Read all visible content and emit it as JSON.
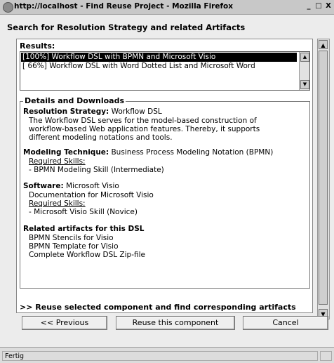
{
  "window": {
    "title": "http://localhost - Find Reuse Project - Mozilla Firefox",
    "minimize_label": "_",
    "maximize_label": "□",
    "close_label": "X"
  },
  "page": {
    "heading": "Search for Resolution Strategy and related Artifacts",
    "results_label": "Results:",
    "results": [
      {
        "label": "[100%] Workflow DSL with BPMN and Microsoft Visio",
        "selected": true
      },
      {
        "label": "[ 66%] Workflow DSL with Word Dotted List and Microsoft Word",
        "selected": false
      }
    ],
    "details": {
      "legend": "Details and Downloads",
      "strategy_label": "Resolution Strategy:",
      "strategy_value": "Workflow DSL",
      "strategy_desc": [
        "The Workflow DSL serves for the model-based construction of",
        "workflow-based Web application features. Thereby, it supports",
        "different modeling notations and tools."
      ],
      "technique_label": "Modeling Technique:",
      "technique_value": "Business Process Modeling Notation (BPMN)",
      "technique_skills_label": "Required Skills:",
      "technique_skill": "- BPMN Modeling Skill (Intermediate)",
      "software_label": "Software:",
      "software_value": "Microsoft Visio",
      "software_doc": "Documentation for Microsoft Visio",
      "software_skills_label": "Required Skills:",
      "software_skill": "- Microsoft Visio Skill (Novice)",
      "related_label": "Related artifacts for this DSL",
      "related_items": [
        "BPMN Stencils for Visio",
        "BPMN Template for Visio",
        "Complete Workflow DSL Zip-file"
      ]
    },
    "reuse_link": ">> Reuse selected component and find corresponding artifacts"
  },
  "buttons": {
    "previous": "<< Previous",
    "reuse": "Reuse this component",
    "cancel": "Cancel"
  },
  "status": {
    "text": "Fertig"
  },
  "icons": {
    "app": "firefox-icon",
    "scroll_up": "arrow-up-icon",
    "scroll_down": "arrow-down-icon"
  }
}
